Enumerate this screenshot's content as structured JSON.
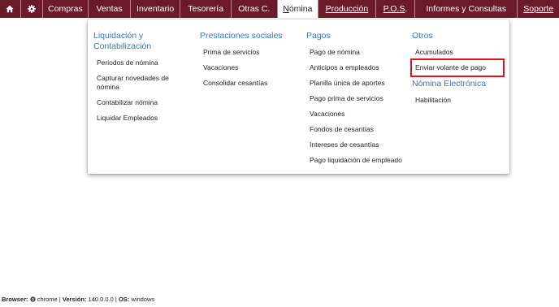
{
  "nav": {
    "home_icon": "home-icon",
    "settings_icon": "gear-icon",
    "items": [
      {
        "label": "Compras"
      },
      {
        "label": "Ventas"
      },
      {
        "label": "Inventario"
      },
      {
        "label": "Tesorería"
      },
      {
        "label": "Otras C."
      },
      {
        "label_underlined": "N",
        "label_rest": "ómina"
      },
      {
        "label_underlined": "P",
        "label_rest": "roducción"
      },
      {
        "label_before": "P.O.",
        "label_underlined": "S",
        "label_after": "."
      },
      {
        "label": "Informes y Consultas"
      },
      {
        "label_underlined": "S",
        "label_rest": "oporte"
      }
    ],
    "colors": {
      "bar": "#6b1a2a",
      "active": "#ffffff"
    }
  },
  "dropdown": {
    "columns": [
      {
        "title": "Liquidación y Contabilización",
        "links": [
          "Periodos de nómina",
          "Capturar novedades de nómina",
          "Contabilizar nómina",
          "Liquidar Empleados"
        ]
      },
      {
        "title": "Prestaciones sociales",
        "links": [
          "Prima de servicios",
          "Vacaciones",
          "Consolidar cesantías"
        ]
      },
      {
        "title": "Pagos",
        "links": [
          "Pago de nómina",
          "Anticipos a empleados",
          "Planilla única de aportes",
          "Pago prima de servicios",
          "Vacaciones",
          "Fondos de cesantías",
          "Intereses de cesantías",
          "Pago liquidación de empleado"
        ]
      },
      {
        "title": "Otros",
        "links": [
          "Acumulados",
          "Enviar volante de pago"
        ],
        "highlighted_link": "Enviar volante de pago",
        "title2": "Nómina Electrónica",
        "links2": [
          "Habilitación"
        ]
      }
    ],
    "colors": {
      "title": "#3a78b0",
      "highlight_border": "#e0121a"
    }
  },
  "footer": {
    "browser_label": "Browser:",
    "browser_icon": "chrome-icon",
    "browser_value": "chrome",
    "version_label": "Versión:",
    "version_value": "140.0.0.0",
    "os_label": "OS:",
    "os_value": "windows",
    "separator": "|"
  }
}
